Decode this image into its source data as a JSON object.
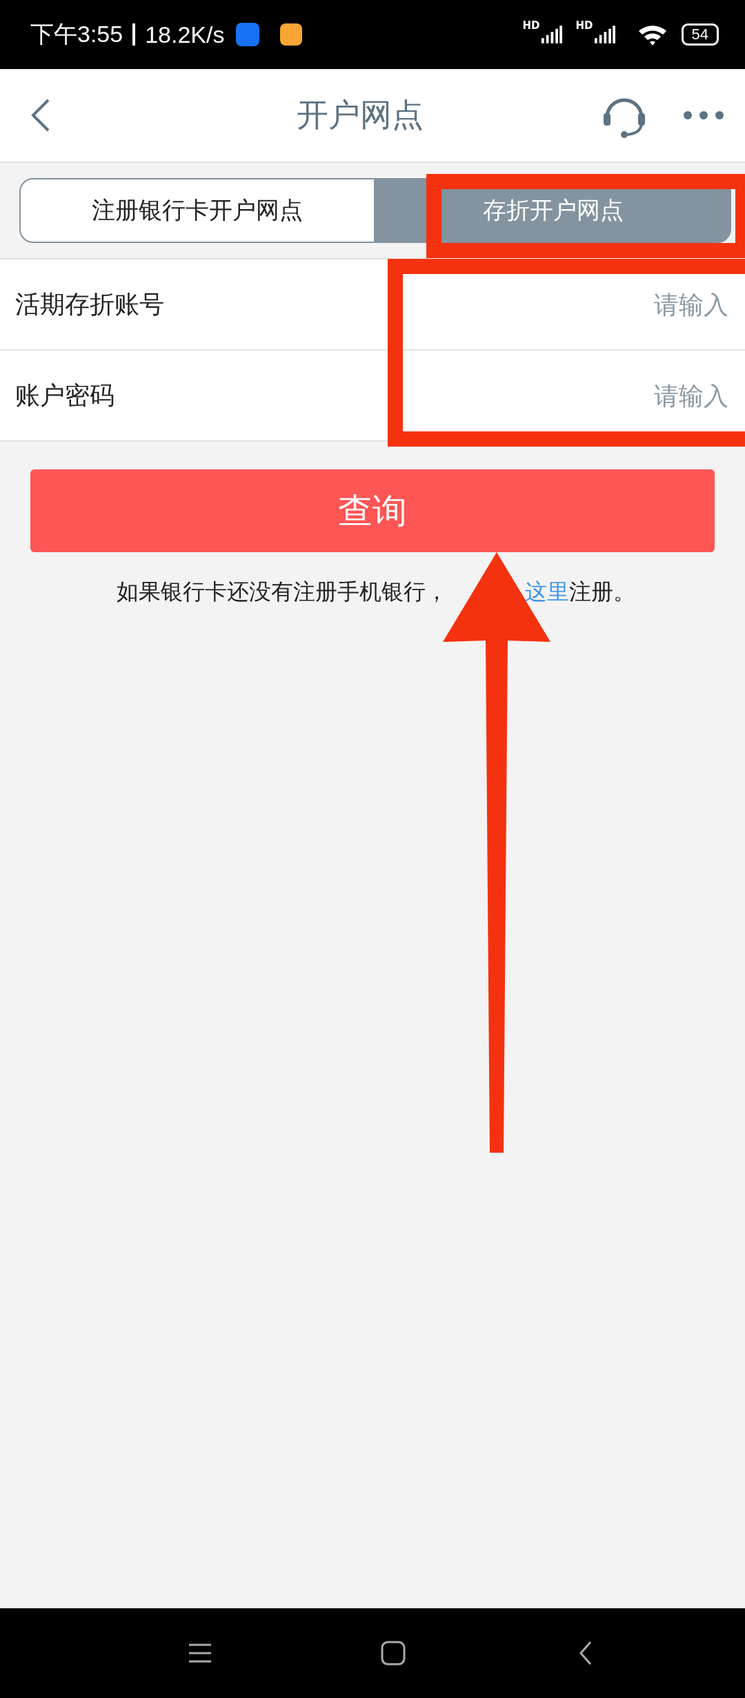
{
  "status_bar": {
    "time": "下午3:55",
    "speed": "18.2K/s",
    "signal_labels": [
      "HD",
      "HD"
    ],
    "battery": "54"
  },
  "header": {
    "title": "开户网点"
  },
  "tabs": [
    {
      "label": "注册银行卡开户网点",
      "selected": false
    },
    {
      "label": "存折开户网点",
      "selected": true
    }
  ],
  "form": [
    {
      "label": "活期存折账号",
      "placeholder": "请输入"
    },
    {
      "label": "账户密码",
      "placeholder": "请输入"
    }
  ],
  "query_button": "查询",
  "hint": {
    "before": "如果银行卡还没有注册手机银行，",
    "link": "这里",
    "after": "注册。"
  }
}
